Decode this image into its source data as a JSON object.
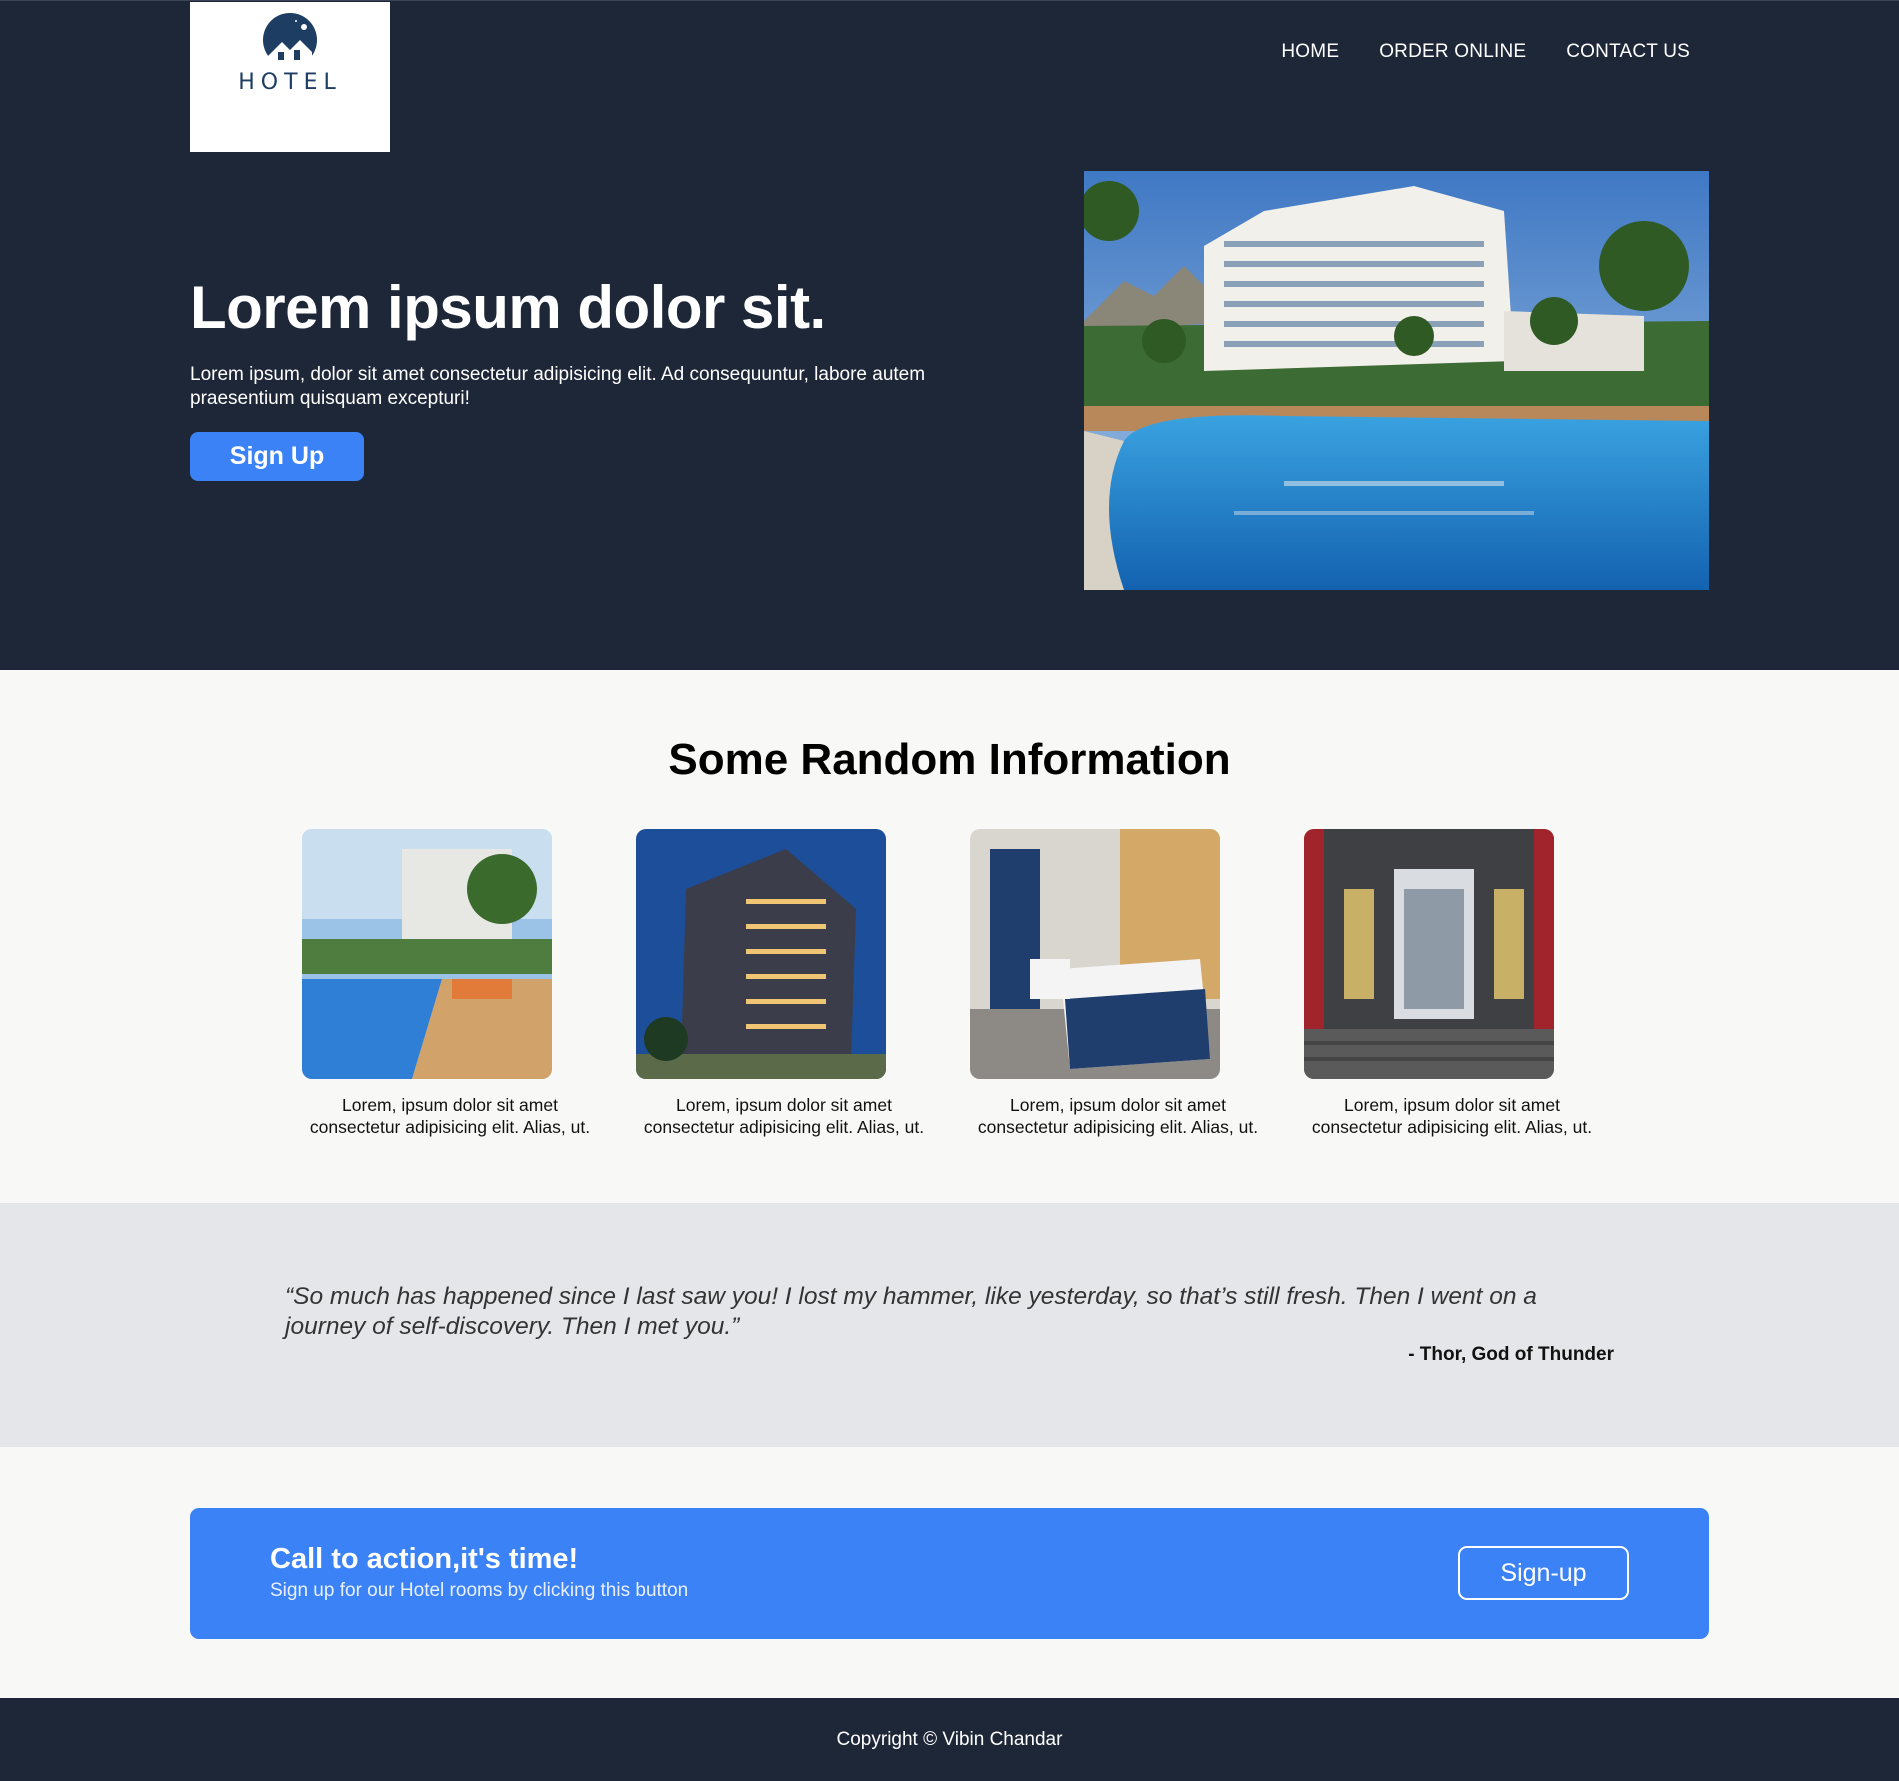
{
  "header": {
    "logo_text": "HOTEL",
    "nav": [
      "HOME",
      "ORDER ONLINE",
      "CONTACT US"
    ]
  },
  "hero": {
    "title": "Lorem ipsum dolor sit.",
    "subtitle": "Lorem ipsum, dolor sit amet consectetur adipisicing elit. Ad consequuntur, labore autem praesentium quisquam excepturi!",
    "button_label": "Sign Up",
    "image": "hotel-pool-photo"
  },
  "info": {
    "title": "Some Random Information",
    "cards": [
      {
        "image": "poolside-deck-photo",
        "caption": "Lorem, ipsum dolor sit amet consectetur adipisicing elit. Alias, ut."
      },
      {
        "image": "hotel-building-night-photo",
        "caption": "Lorem, ipsum dolor sit amet consectetur adipisicing elit. Alias, ut."
      },
      {
        "image": "hotel-bedroom-photo",
        "caption": "Lorem, ipsum dolor sit amet consectetur adipisicing elit. Alias, ut."
      },
      {
        "image": "hotel-entrance-photo",
        "caption": "Lorem, ipsum dolor sit amet consectetur adipisicing elit. Alias, ut."
      }
    ]
  },
  "testimonial": {
    "quote": "“So much has happened since I last saw you! I lost my hammer, like yesterday, so that’s still fresh. Then I went on a journey of self-discovery. Then I met you.”",
    "author": "- Thor, God of Thunder"
  },
  "cta": {
    "title": "Call to action,it's time!",
    "subtitle": "Sign up for our Hotel rooms by clicking this button",
    "button_label": "Sign-up"
  },
  "footer": {
    "copyright": "Copyright © Vibin Chandar"
  },
  "colors": {
    "dark": "#1e2738",
    "accent": "#3b82f6",
    "light_bg": "#f8f8f6",
    "quote_bg": "#e5e6ea"
  }
}
